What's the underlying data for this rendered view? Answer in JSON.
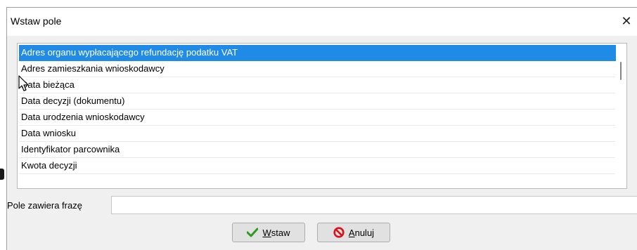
{
  "dialog": {
    "title": "Wstaw pole",
    "close_icon": "close-icon"
  },
  "list": {
    "items": [
      "Adres organu wypłacającego refundację podatku VAT",
      "Adres zamieszkania wnioskodawcy",
      "Data bieżąca",
      "Data decyzji (dokumentu)",
      "Data urodzenia wnioskodawcy",
      "Data wniosku",
      "Identyfikator parcownika",
      "Kwota decyzji"
    ],
    "selected_index": 0
  },
  "filter": {
    "label": "Pole zawiera frazę",
    "value": ""
  },
  "buttons": {
    "insert_first": "W",
    "insert_rest": "staw",
    "insert_icon": "checkmark-icon",
    "cancel_first": "A",
    "cancel_rest": "nuluj",
    "cancel_icon": "no-entry-icon"
  },
  "colors": {
    "selection": "#1f8be6",
    "checkmark": "#2e9a1f",
    "cancel_icon": "#d8141a"
  }
}
